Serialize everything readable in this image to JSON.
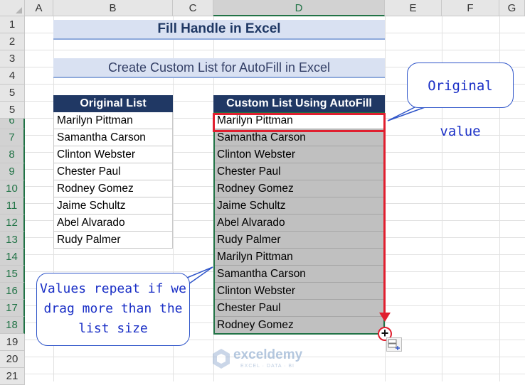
{
  "columns": [
    "A",
    "B",
    "C",
    "D",
    "E",
    "F",
    "G"
  ],
  "rows": [
    "1",
    "2",
    "3",
    "4",
    "5",
    "6",
    "7",
    "8",
    "9",
    "10",
    "11",
    "12",
    "13",
    "14",
    "15",
    "16",
    "17",
    "18",
    "19",
    "20",
    "21"
  ],
  "title": "Fill Handle in Excel",
  "subtitle": "Create Custom List for AutoFill in Excel",
  "original_list": {
    "header": "Original List",
    "items": [
      "Marilyn Pittman",
      "Samantha Carson",
      "Clinton Webster",
      "Chester Paul",
      "Rodney Gomez",
      "Jaime Schultz",
      "Abel Alvarado",
      "Rudy Palmer"
    ]
  },
  "custom_list": {
    "header": "Custom List Using AutoFill",
    "items": [
      "Marilyn Pittman",
      "Samantha Carson",
      "Clinton Webster",
      "Chester Paul",
      "Rodney Gomez",
      "Jaime Schultz",
      "Abel Alvarado",
      "Rudy Palmer",
      "Marilyn Pittman",
      "Samantha Carson",
      "Clinton Webster",
      "Chester Paul",
      "Rodney Gomez"
    ]
  },
  "callouts": {
    "original_value": "Original value",
    "repeat_line1": "Values repeat if we",
    "repeat_line2": "drag more than the",
    "repeat_line3": "list size"
  },
  "watermark": {
    "name": "exceldemy",
    "tagline": "EXCEL · DATA · BI"
  },
  "colors": {
    "accent": "#217346",
    "header_navy": "#203864",
    "highlight_red": "#e01f2f",
    "callout_blue": "#1a2fc6",
    "banner_bg": "#d9e1f2"
  },
  "icons": {
    "fill_handle": "crosshair-plus-icon",
    "autofill_options": "autofill-options-icon"
  }
}
